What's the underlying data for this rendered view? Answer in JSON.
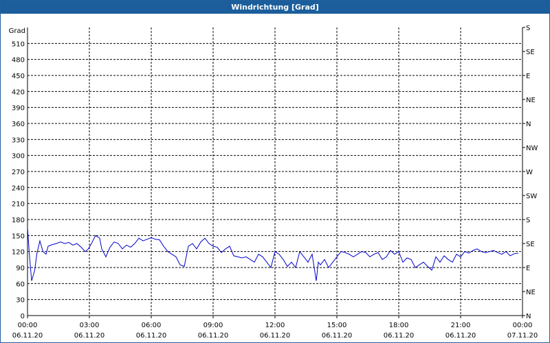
{
  "window": {
    "title": "Windrichtung [Grad]"
  },
  "chart_data": {
    "type": "line",
    "title": "Windrichtung [Grad]",
    "ylabel": "Grad",
    "ylim": [
      0,
      540
    ],
    "y_ticks": [
      0,
      30,
      60,
      90,
      120,
      150,
      180,
      210,
      240,
      270,
      300,
      330,
      360,
      390,
      420,
      450,
      480,
      510
    ],
    "right_ticks": [
      {
        "value": 0,
        "label": "N"
      },
      {
        "value": 45,
        "label": "NE"
      },
      {
        "value": 90,
        "label": "E"
      },
      {
        "value": 135,
        "label": "SE"
      },
      {
        "value": 180,
        "label": "S"
      },
      {
        "value": 225,
        "label": "SW"
      },
      {
        "value": 270,
        "label": "W"
      },
      {
        "value": 315,
        "label": "NW"
      },
      {
        "value": 360,
        "label": "N"
      },
      {
        "value": 405,
        "label": "NE"
      },
      {
        "value": 450,
        "label": "E"
      },
      {
        "value": 495,
        "label": "SE"
      },
      {
        "value": 540,
        "label": "S"
      }
    ],
    "xlim_hours": [
      0,
      24
    ],
    "x_ticks": [
      {
        "time": "00:00",
        "date": "06.11.20"
      },
      {
        "time": "03:00",
        "date": "06.11.20"
      },
      {
        "time": "06:00",
        "date": "06.11.20"
      },
      {
        "time": "09:00",
        "date": "06.11.20"
      },
      {
        "time": "12:00",
        "date": "06.11.20"
      },
      {
        "time": "15:00",
        "date": "06.11.20"
      },
      {
        "time": "18:00",
        "date": "06.11.20"
      },
      {
        "time": "21:00",
        "date": "06.11.20"
      },
      {
        "time": "00:00",
        "date": "07.11.20"
      }
    ],
    "grid": true,
    "line_color": "#0000cc",
    "series": [
      {
        "x": [
          0.0,
          0.1,
          0.2,
          0.35,
          0.45,
          0.6,
          0.75,
          0.9,
          1.0,
          1.2,
          1.4,
          1.6,
          1.8,
          2.0,
          2.2,
          2.4,
          2.6,
          2.8,
          2.95,
          3.1,
          3.3,
          3.5,
          3.6,
          3.8,
          4.0,
          4.2,
          4.4,
          4.6,
          4.8,
          5.0,
          5.2,
          5.4,
          5.6,
          5.8,
          6.0,
          6.2,
          6.4,
          6.6,
          6.8,
          7.0,
          7.2,
          7.4,
          7.6,
          7.8,
          8.0,
          8.2,
          8.4,
          8.6,
          8.8,
          9.0,
          9.2,
          9.4,
          9.6,
          9.8,
          10.0,
          10.2,
          10.4,
          10.6,
          10.8,
          11.0,
          11.2,
          11.4,
          11.6,
          11.8,
          12.0,
          12.2,
          12.4,
          12.6,
          12.8,
          13.0,
          13.2,
          13.4,
          13.6,
          13.8,
          14.0,
          14.1,
          14.2,
          14.4,
          14.6,
          14.8,
          15.0,
          15.2,
          15.4,
          15.6,
          15.8,
          16.0,
          16.2,
          16.4,
          16.6,
          16.8,
          17.0,
          17.2,
          17.4,
          17.6,
          17.8,
          18.0,
          18.2,
          18.4,
          18.6,
          18.8,
          19.0,
          19.2,
          19.4,
          19.6,
          19.8,
          20.0,
          20.2,
          20.4,
          20.6,
          20.8,
          21.0,
          21.2,
          21.4,
          21.6,
          21.8,
          22.0,
          22.2,
          22.4,
          22.6,
          22.8,
          23.0,
          23.2,
          23.4,
          23.6,
          23.8
        ],
        "y": [
          165,
          110,
          65,
          85,
          115,
          140,
          120,
          115,
          130,
          133,
          135,
          138,
          135,
          137,
          132,
          135,
          128,
          120,
          125,
          135,
          150,
          145,
          125,
          110,
          128,
          138,
          135,
          125,
          132,
          128,
          135,
          145,
          140,
          143,
          146,
          143,
          142,
          130,
          120,
          115,
          110,
          95,
          92,
          130,
          135,
          125,
          138,
          145,
          135,
          130,
          128,
          118,
          125,
          130,
          112,
          110,
          108,
          110,
          105,
          100,
          115,
          110,
          100,
          90,
          120,
          115,
          105,
          92,
          100,
          90,
          120,
          110,
          100,
          115,
          65,
          100,
          95,
          105,
          90,
          100,
          110,
          120,
          118,
          115,
          110,
          115,
          120,
          118,
          110,
          115,
          118,
          105,
          110,
          122,
          115,
          120,
          100,
          108,
          105,
          90,
          95,
          100,
          92,
          85,
          110,
          100,
          112,
          105,
          100,
          115,
          110,
          120,
          117,
          122,
          125,
          120,
          118,
          120,
          122,
          118,
          115,
          120,
          112,
          116,
          117
        ]
      }
    ]
  }
}
